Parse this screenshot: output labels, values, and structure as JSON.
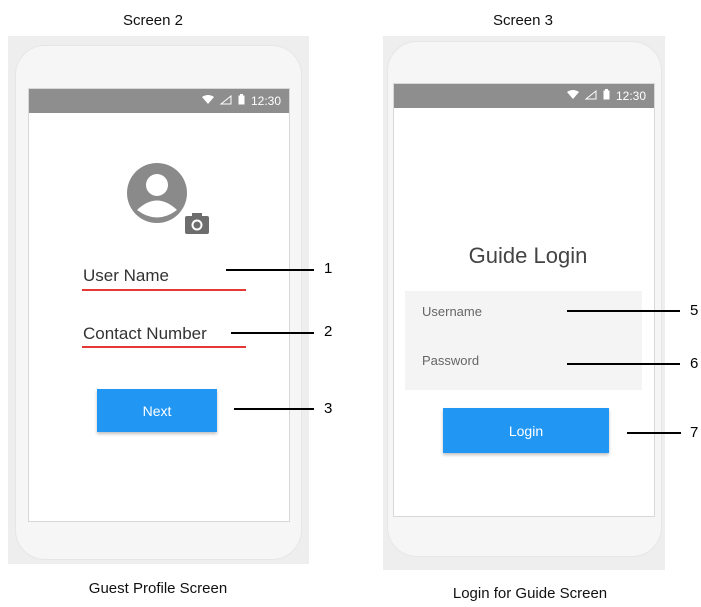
{
  "screen2": {
    "title": "Screen 2",
    "caption": "Guest Profile Screen",
    "status_time": "12:30",
    "user_name_label": "User Name",
    "contact_label": "Contact Number",
    "next_label": "Next",
    "callouts": [
      "1",
      "2",
      "3"
    ]
  },
  "screen3": {
    "title": "Screen 3",
    "caption": "Login for Guide Screen",
    "status_time": "12:30",
    "login_title": "Guide Login",
    "username_label": "Username",
    "password_label": "Password",
    "login_label": "Login",
    "callouts": [
      "5",
      "6",
      "7"
    ]
  },
  "colors": {
    "accent": "#2196f3",
    "underline": "#e53935",
    "statusbar": "#8e8e8e"
  }
}
